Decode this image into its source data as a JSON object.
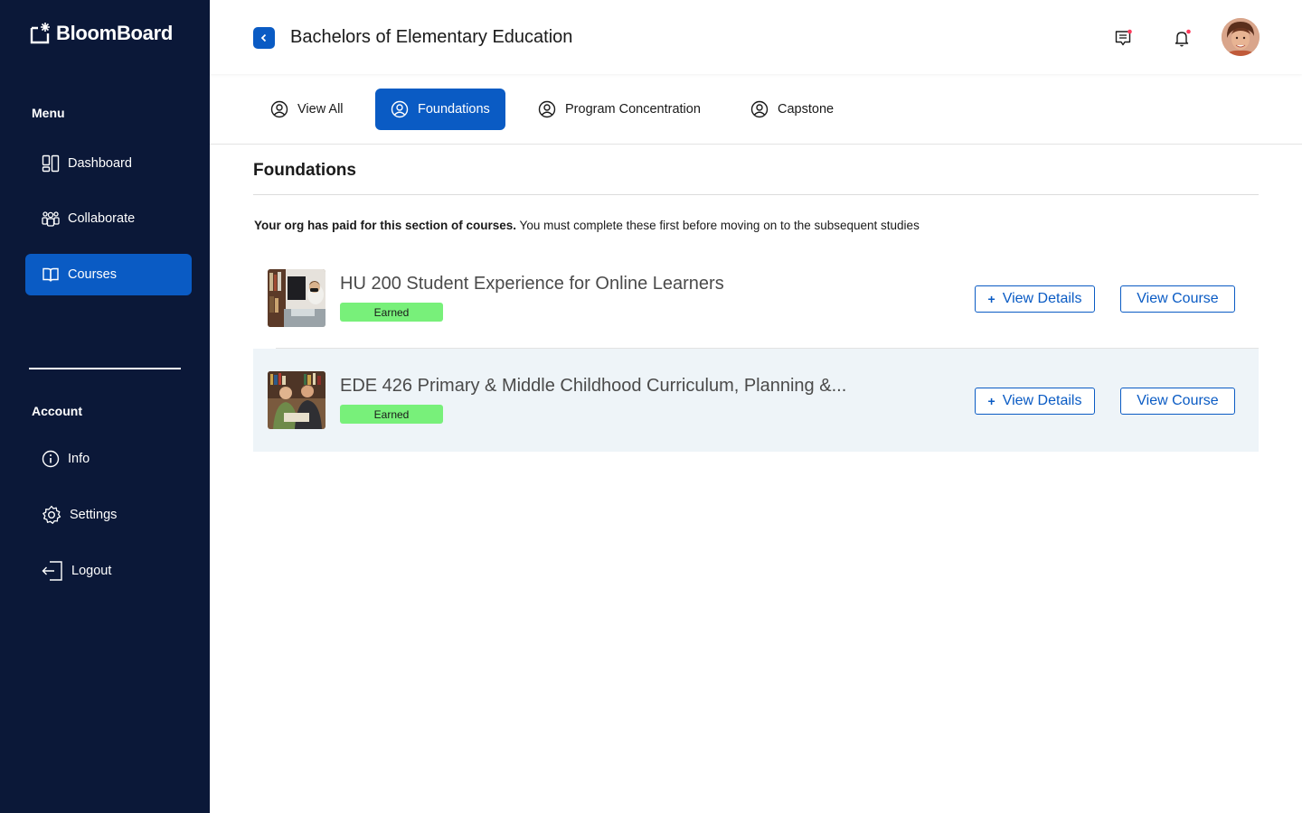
{
  "app": {
    "brand": "BloomBoard"
  },
  "sidebar": {
    "menu_label": "Menu",
    "menu_items": [
      {
        "label": "Dashboard",
        "icon": "dashboard-icon"
      },
      {
        "label": "Collaborate",
        "icon": "people-icon"
      },
      {
        "label": "Courses",
        "icon": "book-icon",
        "active": true
      }
    ],
    "account_label": "Account",
    "account_items": [
      {
        "label": "Info",
        "icon": "info-icon"
      },
      {
        "label": "Settings",
        "icon": "gear-icon"
      },
      {
        "label": "Logout",
        "icon": "logout-icon"
      }
    ]
  },
  "header": {
    "title": "Bachelors of Elementary Education"
  },
  "tabs": [
    {
      "label": "View All"
    },
    {
      "label": "Foundations",
      "active": true
    },
    {
      "label": "Program Concentration"
    },
    {
      "label": "Capstone"
    }
  ],
  "main": {
    "section_title": "Foundations",
    "notice_bold": "Your org has paid for this section of courses.",
    "notice_rest": " You must complete these first before moving on to the subsequent studies",
    "courses": [
      {
        "name": "HU 200 Student Experience for Online Learners",
        "status": "Earned",
        "details_label": "View Details",
        "course_label": "View Course"
      },
      {
        "name": "EDE 426 Primary & Middle Childhood Curriculum,  Planning &...",
        "status": "Earned",
        "details_label": "View Details",
        "course_label": "View Course"
      }
    ]
  },
  "colors": {
    "sidebar_bg": "#0b1838",
    "accent": "#0a5bc4",
    "badge_green": "#78f07a",
    "notification_dot": "#ff3b5c"
  }
}
